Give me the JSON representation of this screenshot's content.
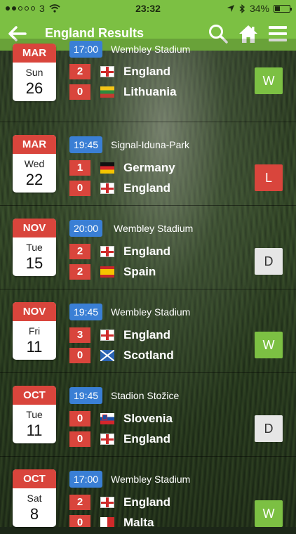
{
  "status_bar": {
    "carrier": "3",
    "time": "23:32",
    "battery": "34%",
    "battery_level": 0.34
  },
  "nav": {
    "title": "England Results",
    "icons": [
      "back-arrow-icon",
      "search-icon",
      "home-icon",
      "menu-icon"
    ]
  },
  "matches": [
    {
      "month": "MAR",
      "weekday": "Sun",
      "day": "26",
      "time": "17:00",
      "venue": "Wembley Stadium",
      "home": {
        "score": "2",
        "team": "England",
        "flag": "eng"
      },
      "away": {
        "score": "0",
        "team": "Lithuania",
        "flag": "ltu"
      },
      "result": "W"
    },
    {
      "month": "MAR",
      "weekday": "Wed",
      "day": "22",
      "time": "19:45",
      "venue": "Signal-Iduna-Park",
      "home": {
        "score": "1",
        "team": "Germany",
        "flag": "ger"
      },
      "away": {
        "score": "0",
        "team": "England",
        "flag": "eng"
      },
      "result": "L"
    },
    {
      "month": "NOV",
      "weekday": "Tue",
      "day": "15",
      "time": "20:00",
      "venue": "Wembley Stadium",
      "home": {
        "score": "2",
        "team": "England",
        "flag": "eng"
      },
      "away": {
        "score": "2",
        "team": "Spain",
        "flag": "esp"
      },
      "result": "D"
    },
    {
      "month": "NOV",
      "weekday": "Fri",
      "day": "11",
      "time": "19:45",
      "venue": "Wembley Stadium",
      "home": {
        "score": "3",
        "team": "England",
        "flag": "eng"
      },
      "away": {
        "score": "0",
        "team": "Scotland",
        "flag": "sco"
      },
      "result": "W"
    },
    {
      "month": "OCT",
      "weekday": "Tue",
      "day": "11",
      "time": "19:45",
      "venue": "Stadion Stožice",
      "home": {
        "score": "0",
        "team": "Slovenia",
        "flag": "svn"
      },
      "away": {
        "score": "0",
        "team": "England",
        "flag": "eng"
      },
      "result": "D"
    },
    {
      "month": "OCT",
      "weekday": "Sat",
      "day": "8",
      "time": "17:00",
      "venue": "Wembley Stadium",
      "home": {
        "score": "2",
        "team": "England",
        "flag": "eng"
      },
      "away": {
        "score": "0",
        "team": "Malta",
        "flag": "mlt"
      },
      "result": "W"
    }
  ]
}
